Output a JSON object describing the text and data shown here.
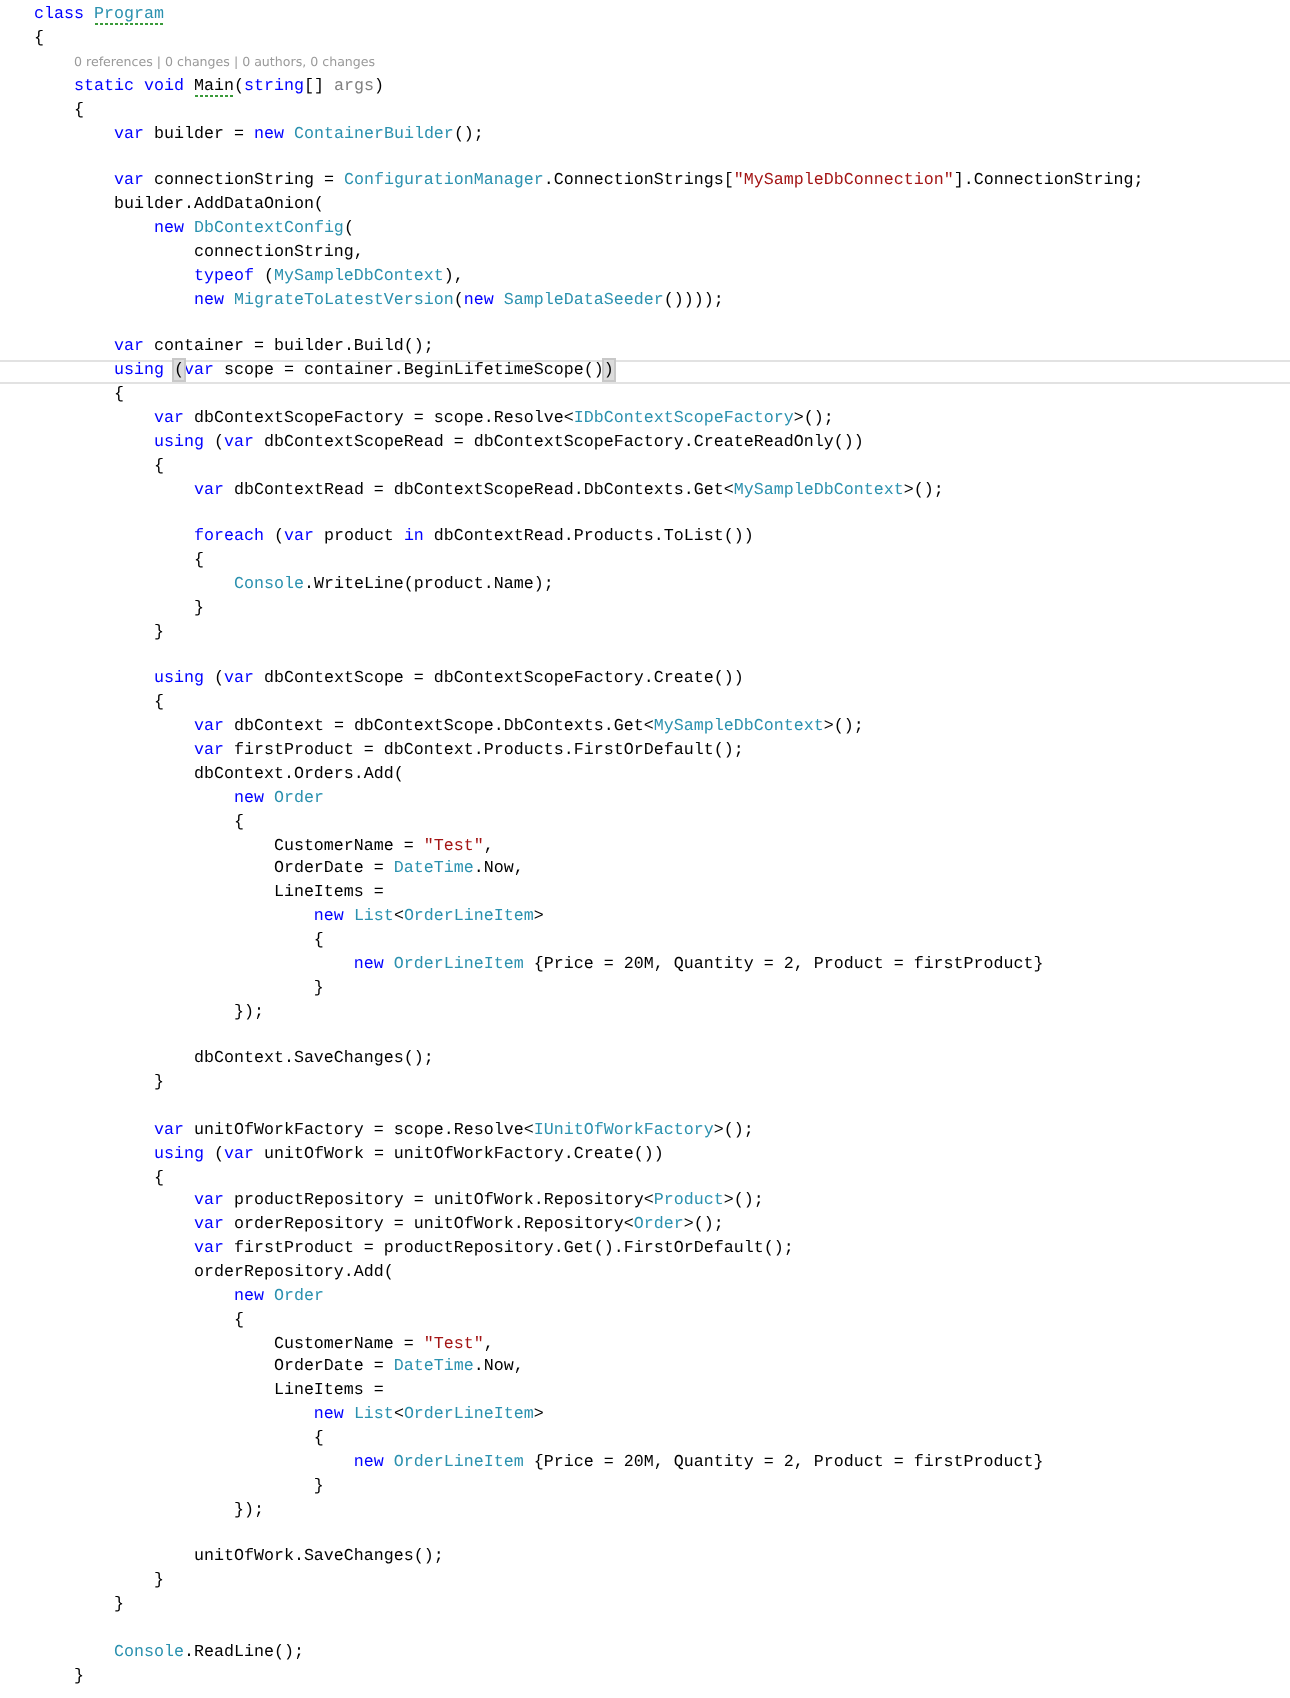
{
  "editor": {
    "lines": [
      {
        "current": false,
        "tokens": [
          {
            "kind": "keyword",
            "text": "class "
          },
          {
            "kind": "hint-type",
            "text": "Program"
          }
        ]
      },
      {
        "current": false,
        "tokens": [
          {
            "kind": "plain",
            "text": "{"
          }
        ]
      },
      {
        "current": false,
        "tokens": [
          {
            "kind": "codelens",
            "text": "0 references | 0 changes | 0 authors, 0 changes"
          }
        ]
      },
      {
        "current": false,
        "tokens": [
          {
            "kind": "keyword",
            "text": "    static void "
          },
          {
            "kind": "hint-ident",
            "text": "Main"
          },
          {
            "kind": "plain",
            "text": "("
          },
          {
            "kind": "keyword",
            "text": "string"
          },
          {
            "kind": "plain",
            "text": "[] "
          },
          {
            "kind": "param",
            "text": "args"
          },
          {
            "kind": "plain",
            "text": ")"
          }
        ]
      },
      {
        "current": false,
        "tokens": [
          {
            "kind": "plain",
            "text": "    {"
          }
        ]
      },
      {
        "current": false,
        "tokens": [
          {
            "kind": "keyword",
            "text": "        var"
          },
          {
            "kind": "plain",
            "text": " builder = "
          },
          {
            "kind": "keyword",
            "text": "new "
          },
          {
            "kind": "type",
            "text": "ContainerBuilder"
          },
          {
            "kind": "plain",
            "text": "();"
          }
        ]
      },
      {
        "current": false
      },
      {
        "current": false,
        "tokens": [
          {
            "kind": "keyword",
            "text": "        var"
          },
          {
            "kind": "plain",
            "text": " connectionString = "
          },
          {
            "kind": "type",
            "text": "ConfigurationManager"
          },
          {
            "kind": "plain",
            "text": ".ConnectionStrings["
          },
          {
            "kind": "string",
            "text": "\"MySampleDbConnection\""
          },
          {
            "kind": "plain",
            "text": "].ConnectionString;"
          }
        ]
      },
      {
        "current": false,
        "tokens": [
          {
            "kind": "plain",
            "text": "        builder.AddDataOnion("
          }
        ]
      },
      {
        "current": false,
        "tokens": [
          {
            "kind": "keyword",
            "text": "            new "
          },
          {
            "kind": "type",
            "text": "DbContextConfig"
          },
          {
            "kind": "plain",
            "text": "("
          }
        ]
      },
      {
        "current": false,
        "tokens": [
          {
            "kind": "plain",
            "text": "                connectionString,"
          }
        ]
      },
      {
        "current": false,
        "tokens": [
          {
            "kind": "keyword",
            "text": "                typeof"
          },
          {
            "kind": "plain",
            "text": " ("
          },
          {
            "kind": "type",
            "text": "MySampleDbContext"
          },
          {
            "kind": "plain",
            "text": "),"
          }
        ]
      },
      {
        "current": false,
        "tokens": [
          {
            "kind": "keyword",
            "text": "                new "
          },
          {
            "kind": "type",
            "text": "MigrateToLatestVersion"
          },
          {
            "kind": "plain",
            "text": "("
          },
          {
            "kind": "keyword",
            "text": "new "
          },
          {
            "kind": "type",
            "text": "SampleDataSeeder"
          },
          {
            "kind": "plain",
            "text": "())));"
          }
        ]
      },
      {
        "current": false
      },
      {
        "current": false,
        "tokens": [
          {
            "kind": "keyword",
            "text": "        var"
          },
          {
            "kind": "plain",
            "text": " container = builder.Build();"
          }
        ]
      },
      {
        "current": true,
        "tokens": [
          {
            "kind": "keyword",
            "text": "        using "
          },
          {
            "kind": "match",
            "text": "("
          },
          {
            "kind": "keyword",
            "text": "var"
          },
          {
            "kind": "plain",
            "text": " scope = container.BeginLifetimeScope()"
          },
          {
            "kind": "match",
            "text": ")"
          }
        ]
      },
      {
        "current": false,
        "tokens": [
          {
            "kind": "plain",
            "text": "        {"
          }
        ]
      },
      {
        "current": false,
        "tokens": [
          {
            "kind": "keyword",
            "text": "            var"
          },
          {
            "kind": "plain",
            "text": " dbContextScopeFactory = scope.Resolve<"
          },
          {
            "kind": "type",
            "text": "IDbContextScopeFactory"
          },
          {
            "kind": "plain",
            "text": ">();"
          }
        ]
      },
      {
        "current": false,
        "tokens": [
          {
            "kind": "keyword",
            "text": "            using"
          },
          {
            "kind": "plain",
            "text": " ("
          },
          {
            "kind": "keyword",
            "text": "var"
          },
          {
            "kind": "plain",
            "text": " dbContextScopeRead = dbContextScopeFactory.CreateReadOnly())"
          }
        ]
      },
      {
        "current": false,
        "tokens": [
          {
            "kind": "plain",
            "text": "            {"
          }
        ]
      },
      {
        "current": false,
        "tokens": [
          {
            "kind": "keyword",
            "text": "                var"
          },
          {
            "kind": "plain",
            "text": " dbContextRead = dbContextScopeRead.DbContexts.Get<"
          },
          {
            "kind": "type",
            "text": "MySampleDbContext"
          },
          {
            "kind": "plain",
            "text": ">();"
          }
        ]
      },
      {
        "current": false
      },
      {
        "current": false,
        "tokens": [
          {
            "kind": "keyword",
            "text": "                foreach"
          },
          {
            "kind": "plain",
            "text": " ("
          },
          {
            "kind": "keyword",
            "text": "var"
          },
          {
            "kind": "plain",
            "text": " product "
          },
          {
            "kind": "keyword",
            "text": "in"
          },
          {
            "kind": "plain",
            "text": " dbContextRead.Products.ToList())"
          }
        ]
      },
      {
        "current": false,
        "tokens": [
          {
            "kind": "plain",
            "text": "                {"
          }
        ]
      },
      {
        "current": false,
        "tokens": [
          {
            "kind": "type",
            "text": "                    Console"
          },
          {
            "kind": "plain",
            "text": ".WriteLine(product.Name);"
          }
        ]
      },
      {
        "current": false,
        "tokens": [
          {
            "kind": "plain",
            "text": "                }"
          }
        ]
      },
      {
        "current": false,
        "tokens": [
          {
            "kind": "plain",
            "text": "            }"
          }
        ]
      },
      {
        "current": false
      },
      {
        "current": false,
        "tokens": [
          {
            "kind": "keyword",
            "text": "            using"
          },
          {
            "kind": "plain",
            "text": " ("
          },
          {
            "kind": "keyword",
            "text": "var"
          },
          {
            "kind": "plain",
            "text": " dbContextScope = dbContextScopeFactory.Create())"
          }
        ]
      },
      {
        "current": false,
        "tokens": [
          {
            "kind": "plain",
            "text": "            {"
          }
        ]
      },
      {
        "current": false,
        "tokens": [
          {
            "kind": "keyword",
            "text": "                var"
          },
          {
            "kind": "plain",
            "text": " dbContext = dbContextScope.DbContexts.Get<"
          },
          {
            "kind": "type",
            "text": "MySampleDbContext"
          },
          {
            "kind": "plain",
            "text": ">();"
          }
        ]
      },
      {
        "current": false,
        "tokens": [
          {
            "kind": "keyword",
            "text": "                var"
          },
          {
            "kind": "plain",
            "text": " firstProduct = dbContext.Products.FirstOrDefault();"
          }
        ]
      },
      {
        "current": false,
        "tokens": [
          {
            "kind": "plain",
            "text": "                dbContext.Orders.Add("
          }
        ]
      },
      {
        "current": false,
        "tokens": [
          {
            "kind": "keyword",
            "text": "                    new "
          },
          {
            "kind": "type",
            "text": "Order"
          }
        ]
      },
      {
        "current": false,
        "tokens": [
          {
            "kind": "plain",
            "text": "                    {"
          }
        ]
      },
      {
        "current": false,
        "tokens": [
          {
            "kind": "plain",
            "text": "                        CustomerName = "
          },
          {
            "kind": "string",
            "text": "\"Test\""
          },
          {
            "kind": "plain",
            "text": ","
          }
        ]
      },
      {
        "current": false,
        "tokens": [
          {
            "kind": "plain",
            "text": "                        OrderDate = "
          },
          {
            "kind": "type",
            "text": "DateTime"
          },
          {
            "kind": "plain",
            "text": ".Now,"
          }
        ]
      },
      {
        "current": false,
        "tokens": [
          {
            "kind": "plain",
            "text": "                        LineItems ="
          }
        ]
      },
      {
        "current": false,
        "tokens": [
          {
            "kind": "keyword",
            "text": "                            new "
          },
          {
            "kind": "type",
            "text": "List"
          },
          {
            "kind": "plain",
            "text": "<"
          },
          {
            "kind": "type",
            "text": "OrderLineItem"
          },
          {
            "kind": "plain",
            "text": ">"
          }
        ]
      },
      {
        "current": false,
        "tokens": [
          {
            "kind": "plain",
            "text": "                            {"
          }
        ]
      },
      {
        "current": false,
        "tokens": [
          {
            "kind": "keyword",
            "text": "                                new "
          },
          {
            "kind": "type",
            "text": "OrderLineItem"
          },
          {
            "kind": "plain",
            "text": " {Price = 20M, Quantity = 2, Product = firstProduct}"
          }
        ]
      },
      {
        "current": false,
        "tokens": [
          {
            "kind": "plain",
            "text": "                            }"
          }
        ]
      },
      {
        "current": false,
        "tokens": [
          {
            "kind": "plain",
            "text": "                    });"
          }
        ]
      },
      {
        "current": false
      },
      {
        "current": false,
        "tokens": [
          {
            "kind": "plain",
            "text": "                dbContext.SaveChanges();"
          }
        ]
      },
      {
        "current": false,
        "tokens": [
          {
            "kind": "plain",
            "text": "            }"
          }
        ]
      },
      {
        "current": false
      },
      {
        "current": false,
        "tokens": [
          {
            "kind": "keyword",
            "text": "            var"
          },
          {
            "kind": "plain",
            "text": " unitOfWorkFactory = scope.Resolve<"
          },
          {
            "kind": "type",
            "text": "IUnitOfWorkFactory"
          },
          {
            "kind": "plain",
            "text": ">();"
          }
        ]
      },
      {
        "current": false,
        "tokens": [
          {
            "kind": "keyword",
            "text": "            using"
          },
          {
            "kind": "plain",
            "text": " ("
          },
          {
            "kind": "keyword",
            "text": "var"
          },
          {
            "kind": "plain",
            "text": " unitOfWork = unitOfWorkFactory.Create())"
          }
        ]
      },
      {
        "current": false,
        "tokens": [
          {
            "kind": "plain",
            "text": "            {"
          }
        ]
      },
      {
        "current": false,
        "tokens": [
          {
            "kind": "keyword",
            "text": "                var"
          },
          {
            "kind": "plain",
            "text": " productRepository = unitOfWork.Repository<"
          },
          {
            "kind": "type",
            "text": "Product"
          },
          {
            "kind": "plain",
            "text": ">();"
          }
        ]
      },
      {
        "current": false,
        "tokens": [
          {
            "kind": "keyword",
            "text": "                var"
          },
          {
            "kind": "plain",
            "text": " orderRepository = unitOfWork.Repository<"
          },
          {
            "kind": "type",
            "text": "Order"
          },
          {
            "kind": "plain",
            "text": ">();"
          }
        ]
      },
      {
        "current": false,
        "tokens": [
          {
            "kind": "keyword",
            "text": "                var"
          },
          {
            "kind": "plain",
            "text": " firstProduct = productRepository.Get().FirstOrDefault();"
          }
        ]
      },
      {
        "current": false,
        "tokens": [
          {
            "kind": "plain",
            "text": "                orderRepository.Add("
          }
        ]
      },
      {
        "current": false,
        "tokens": [
          {
            "kind": "keyword",
            "text": "                    new "
          },
          {
            "kind": "type",
            "text": "Order"
          }
        ]
      },
      {
        "current": false,
        "tokens": [
          {
            "kind": "plain",
            "text": "                    {"
          }
        ]
      },
      {
        "current": false,
        "tokens": [
          {
            "kind": "plain",
            "text": "                        CustomerName = "
          },
          {
            "kind": "string",
            "text": "\"Test\""
          },
          {
            "kind": "plain",
            "text": ","
          }
        ]
      },
      {
        "current": false,
        "tokens": [
          {
            "kind": "plain",
            "text": "                        OrderDate = "
          },
          {
            "kind": "type",
            "text": "DateTime"
          },
          {
            "kind": "plain",
            "text": ".Now,"
          }
        ]
      },
      {
        "current": false,
        "tokens": [
          {
            "kind": "plain",
            "text": "                        LineItems ="
          }
        ]
      },
      {
        "current": false,
        "tokens": [
          {
            "kind": "keyword",
            "text": "                            new "
          },
          {
            "kind": "type",
            "text": "List"
          },
          {
            "kind": "plain",
            "text": "<"
          },
          {
            "kind": "type",
            "text": "OrderLineItem"
          },
          {
            "kind": "plain",
            "text": ">"
          }
        ]
      },
      {
        "current": false,
        "tokens": [
          {
            "kind": "plain",
            "text": "                            {"
          }
        ]
      },
      {
        "current": false,
        "tokens": [
          {
            "kind": "keyword",
            "text": "                                new "
          },
          {
            "kind": "type",
            "text": "OrderLineItem"
          },
          {
            "kind": "plain",
            "text": " {Price = 20M, Quantity = 2, Product = firstProduct}"
          }
        ]
      },
      {
        "current": false,
        "tokens": [
          {
            "kind": "plain",
            "text": "                            }"
          }
        ]
      },
      {
        "current": false,
        "tokens": [
          {
            "kind": "plain",
            "text": "                    });"
          }
        ]
      },
      {
        "current": false
      },
      {
        "current": false,
        "tokens": [
          {
            "kind": "plain",
            "text": "                unitOfWork.SaveChanges();"
          }
        ]
      },
      {
        "current": false,
        "tokens": [
          {
            "kind": "plain",
            "text": "            }"
          }
        ]
      },
      {
        "current": false,
        "tokens": [
          {
            "kind": "plain",
            "text": "        }"
          }
        ]
      },
      {
        "current": false
      },
      {
        "current": false,
        "tokens": [
          {
            "kind": "type",
            "text": "        Console"
          },
          {
            "kind": "plain",
            "text": ".ReadLine();"
          }
        ]
      },
      {
        "current": false,
        "tokens": [
          {
            "kind": "plain",
            "text": "    }"
          }
        ]
      }
    ]
  }
}
